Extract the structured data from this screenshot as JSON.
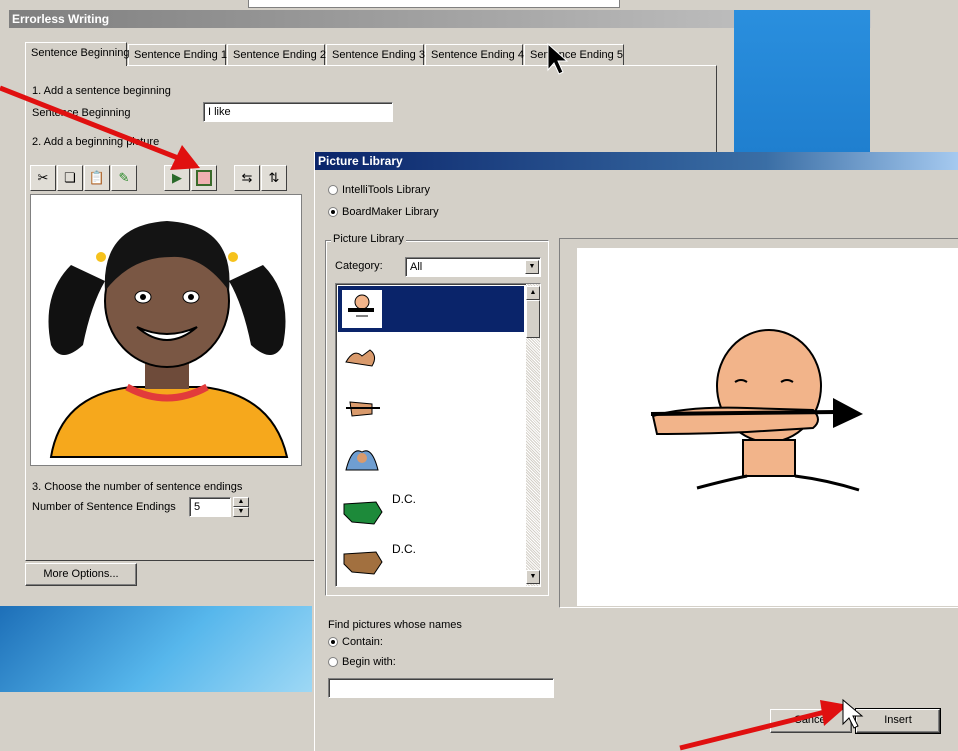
{
  "ew": {
    "title": "Errorless Writing",
    "tabs": [
      "Sentence Beginning",
      "Sentence Ending 1",
      "Sentence Ending 2",
      "Sentence Ending 3",
      "Sentence Ending 4",
      "Sentence Ending 5"
    ],
    "step1": "1. Add a sentence beginning",
    "sb_label": "Sentence Beginning",
    "sb_value": "I like",
    "step2": "2. Add a beginning picture",
    "toolbar_icons": [
      "cut-icon",
      "copy-icon",
      "paste-icon",
      "clear-icon",
      "import-picture-icon",
      "picture-library-icon",
      "swap-horizontal-icon",
      "swap-vertical-icon"
    ],
    "step3": "3. Choose the number of sentence endings",
    "num_label": "Number of Sentence Endings",
    "num_value": "5",
    "more_options": "More Options..."
  },
  "pl": {
    "title": "Picture Library",
    "lib_options": [
      "IntelliTools Library",
      "BoardMaker Library"
    ],
    "selected_lib": "BoardMaker Library",
    "group_title": "Picture Library",
    "category_label": "Category:",
    "category_value": "All",
    "items": [
      {
        "label": "",
        "icon": "eat-sign-icon",
        "selected": true
      },
      {
        "label": "",
        "icon": "hands-sign-icon",
        "selected": false
      },
      {
        "label": "",
        "icon": "hand-sign-icon",
        "selected": false
      },
      {
        "label": "",
        "icon": "clap-sign-icon",
        "selected": false
      },
      {
        "label": "D.C.",
        "icon": "map-green-icon",
        "selected": false
      },
      {
        "label": "D.C.",
        "icon": "map-brown-icon",
        "selected": false
      }
    ],
    "find_label": "Find pictures whose names",
    "contain": "Contain:",
    "begin_with": "Begin with:",
    "search_value": "",
    "cancel": "Cancel",
    "insert": "Insert"
  }
}
